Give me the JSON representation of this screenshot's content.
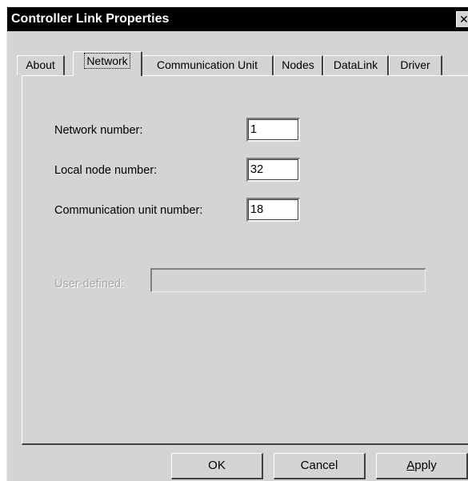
{
  "window": {
    "title": "Controller Link Properties",
    "close_glyph": "✕"
  },
  "tabs": [
    {
      "label": "About"
    },
    {
      "label": "Network"
    },
    {
      "label": "Communication Unit"
    },
    {
      "label": "Nodes"
    },
    {
      "label": "DataLink"
    },
    {
      "label": "Driver"
    }
  ],
  "active_tab": "Network",
  "form": {
    "network_number": {
      "label": "Network number:",
      "value": "1"
    },
    "local_node_number": {
      "label": "Local node number:",
      "value": "32"
    },
    "communication_unit_number": {
      "label": "Communication unit number:",
      "value": "18"
    },
    "user_defined": {
      "label": "User-defined:",
      "value": "",
      "enabled": false
    }
  },
  "buttons": {
    "ok": "OK",
    "cancel": "Cancel",
    "apply": "Apply"
  },
  "colors": {
    "face": "#d4d4d4",
    "titlebar": "#000000",
    "disabled_text": "#a8a8a8"
  }
}
